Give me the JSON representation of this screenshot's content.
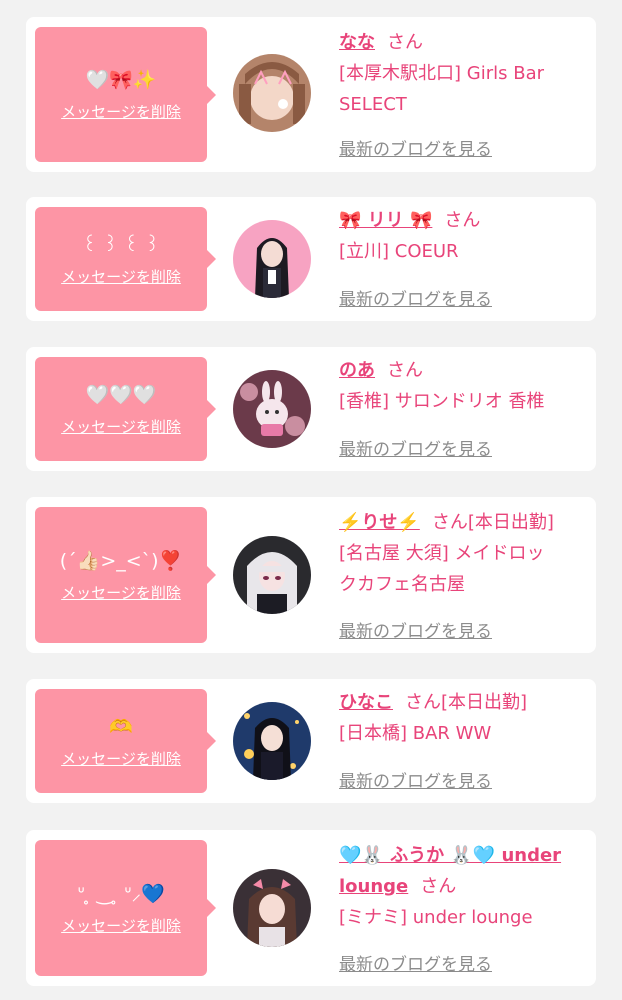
{
  "delete_label": "メッセージを削除",
  "blog_label": "最新のブログを見る",
  "san_label": "さん",
  "colors": {
    "bubble": "#fd95a5",
    "accent": "#e8447a",
    "link_gray": "#8c8c8c",
    "background": "#f2f2f2"
  },
  "messages": [
    {
      "message": "🤍🎀✨",
      "name": "なな",
      "tag": "",
      "shop_lines": [
        "[本厚木駅北口] Girls Bar",
        "SELECT"
      ]
    },
    {
      "message": "꒰ ꒱ ꒰ ꒱",
      "name": "🎀 リリ 🎀",
      "tag": "",
      "shop_lines": [
        "[立川] COEUR"
      ]
    },
    {
      "message": "🤍🤍🤍",
      "name": "のあ",
      "tag": "",
      "shop_lines": [
        "[香椎] サロンドリオ 香椎"
      ]
    },
    {
      "message": "(ˊ👍🏻>_<ˋ)❣️",
      "name": "⚡️りせ⚡️",
      "tag": "[本日出勤]",
      "shop_lines": [
        "[名古屋 大須] メイドロッ",
        "クカフェ名古屋"
      ]
    },
    {
      "message": "🫶",
      "name": "ひなこ",
      "tag": "[本日出勤]",
      "shop_lines": [
        "[日本橋] BAR WW"
      ]
    },
    {
      "message": "ᐡ ̥ ‿ ̥ ᐡ⸝💙",
      "name_lines": [
        "🩵🐰 ふうか 🐰🩵 under",
        "lounge"
      ],
      "tag": "",
      "shop_lines": [
        "[ミナミ] under lounge"
      ]
    }
  ]
}
